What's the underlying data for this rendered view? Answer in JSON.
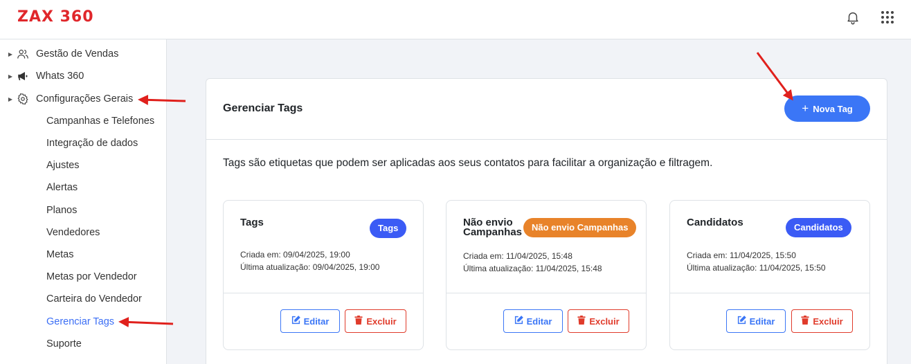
{
  "app": {
    "logo": "ZAX 360"
  },
  "header_icons": [
    {
      "name": "bell-icon"
    },
    {
      "name": "apps-grid-icon"
    }
  ],
  "sidebar": {
    "items": [
      {
        "label": "Gestão de Vendas",
        "icon": "users-icon"
      },
      {
        "label": "Whats 360",
        "icon": "megaphone-icon"
      },
      {
        "label": "Configurações Gerais",
        "icon": "gear-icon"
      }
    ],
    "subitems": [
      {
        "label": "Campanhas e Telefones",
        "active": false
      },
      {
        "label": "Integração de dados",
        "active": false
      },
      {
        "label": "Ajustes",
        "active": false
      },
      {
        "label": "Alertas",
        "active": false
      },
      {
        "label": "Planos",
        "active": false
      },
      {
        "label": "Vendedores",
        "active": false
      },
      {
        "label": "Metas",
        "active": false
      },
      {
        "label": "Metas por Vendedor",
        "active": false
      },
      {
        "label": "Carteira do Vendedor",
        "active": false
      },
      {
        "label": "Gerenciar Tags",
        "active": true
      },
      {
        "label": "Suporte",
        "active": false
      }
    ]
  },
  "main": {
    "title": "Gerenciar Tags",
    "new_button": "Nova Tag",
    "description": "Tags são etiquetas que podem ser aplicadas aos seus contatos para facilitar a organização e filtragem.",
    "cards": [
      {
        "name": "Tags",
        "badge": "Tags",
        "badge_color": "#3b5bf5",
        "created": "Criada em: 09/04/2025, 19:00",
        "updated": "Última atualização: 09/04/2025, 19:00",
        "edit_label": "Editar",
        "delete_label": "Excluir"
      },
      {
        "name": "Não envio Campanhas",
        "badge": "Não envio Campanhas",
        "badge_color": "#e8832a",
        "created": "Criada em: 11/04/2025, 15:48",
        "updated": "Última atualização: 11/04/2025, 15:48",
        "edit_label": "Editar",
        "delete_label": "Excluir"
      },
      {
        "name": "Candidatos",
        "badge": "Candidatos",
        "badge_color": "#3b5bf5",
        "created": "Criada em: 11/04/2025, 15:50",
        "updated": "Última atualização: 11/04/2025, 15:50",
        "edit_label": "Editar",
        "delete_label": "Excluir"
      }
    ]
  },
  "colors": {
    "accent": "#3b76f6",
    "danger": "#e03b2b",
    "brand": "#e0272b",
    "annotation_arrow": "#e0201c"
  }
}
